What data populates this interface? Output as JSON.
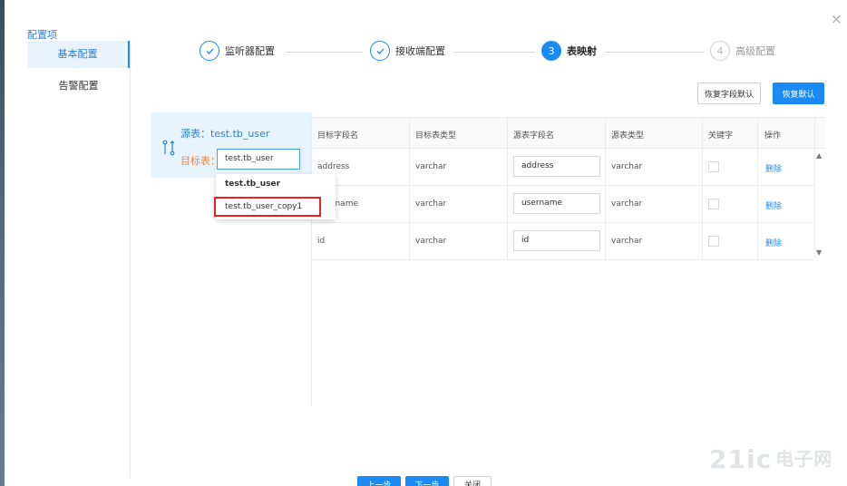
{
  "dialog": {
    "close_label": "×"
  },
  "sidebar": {
    "title": "配置项",
    "items": [
      {
        "label": "基本配置"
      },
      {
        "label": "告警配置"
      }
    ]
  },
  "steps": [
    {
      "label": "监听器配置",
      "state": "done",
      "icon": "check-icon"
    },
    {
      "label": "接收端配置",
      "state": "done",
      "icon": "check-icon"
    },
    {
      "number": "3",
      "label": "表映射",
      "state": "active"
    },
    {
      "number": "4",
      "label": "高级配置",
      "state": "pending"
    }
  ],
  "toolbar": {
    "restore_field_default": "恢复字段默认",
    "restore_default": "恢复默认"
  },
  "mapping": {
    "source_label": "源表：test.tb_user",
    "target_label": "目标表：",
    "target_value": "test.tb_user",
    "dropdown_options": [
      "test.tb_user",
      "test.tb_user_copy1"
    ]
  },
  "table": {
    "headers": [
      "目标字段名",
      "目标表类型",
      "源表字段名",
      "源表类型",
      "关键字",
      "操作"
    ],
    "rows": [
      {
        "target_field": "address",
        "target_type": "varchar",
        "source_field": "address",
        "source_type": "varchar",
        "action": "删除"
      },
      {
        "target_field": "username",
        "target_type": "varchar",
        "source_field": "username",
        "source_type": "varchar",
        "action": "删除"
      },
      {
        "target_field": "id",
        "target_type": "varchar",
        "source_field": "id",
        "source_type": "varchar",
        "action": "删除"
      }
    ]
  },
  "footer": {
    "prev": "上一步",
    "next": "下一步",
    "close": "关闭"
  },
  "watermark": {
    "text": "21ic",
    "cn": "电子网"
  },
  "colors": {
    "primary": "#1b8af5",
    "highlight_border": "#e0251c",
    "source_bg": "#e8f4fd",
    "target_label": "#e9864b"
  }
}
